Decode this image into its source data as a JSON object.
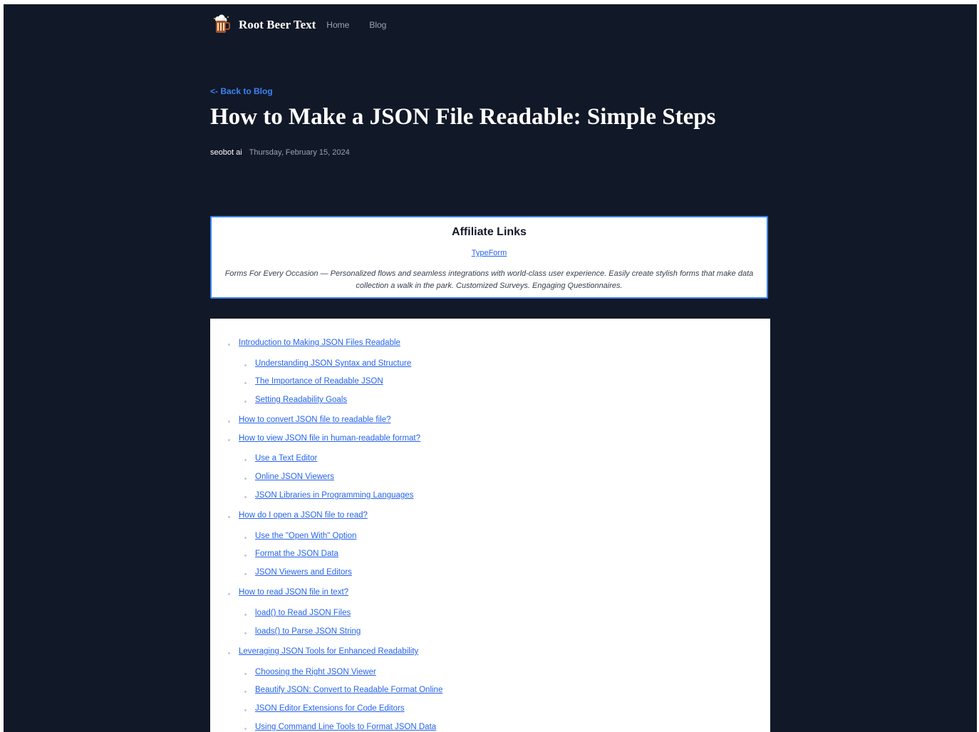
{
  "header": {
    "brand": "Root Beer Text",
    "nav": [
      {
        "label": "Home"
      },
      {
        "label": "Blog"
      }
    ]
  },
  "post": {
    "back_link": "<- Back to Blog",
    "title": "How to Make a JSON File Readable: Simple Steps",
    "author": "seobot ai",
    "date": "Thursday, February 15, 2024"
  },
  "affiliate": {
    "title": "Affiliate Links",
    "link_text": "TypeForm",
    "description": "Forms For Every Occasion — Personalized flows and seamless integrations with world-class user experience. Easily create stylish forms that make data collection a walk in the park. Customized Surveys. Engaging Questionnaires."
  },
  "toc": [
    {
      "level": 1,
      "label": "Introduction to Making JSON Files Readable"
    },
    {
      "level": 2,
      "label": "Understanding JSON Syntax and Structure"
    },
    {
      "level": 2,
      "label": "The Importance of Readable JSON"
    },
    {
      "level": 2,
      "label": "Setting Readability Goals"
    },
    {
      "level": 1,
      "label": "How to convert JSON file to readable file?"
    },
    {
      "level": 1,
      "label": "How to view JSON file in human-readable format?"
    },
    {
      "level": 2,
      "label": "Use a Text Editor"
    },
    {
      "level": 2,
      "label": "Online JSON Viewers"
    },
    {
      "level": 2,
      "label": "JSON Libraries in Programming Languages"
    },
    {
      "level": 1,
      "label": "How do I open a JSON file to read?"
    },
    {
      "level": 2,
      "label": "Use the \"Open With\" Option"
    },
    {
      "level": 2,
      "label": "Format the JSON Data"
    },
    {
      "level": 2,
      "label": "JSON Viewers and Editors"
    },
    {
      "level": 1,
      "label": "How to read JSON file in text?"
    },
    {
      "level": 2,
      "label": "load() to Read JSON Files"
    },
    {
      "level": 2,
      "label": "loads() to Parse JSON String"
    },
    {
      "level": 1,
      "label": "Leveraging JSON Tools for Enhanced Readability"
    },
    {
      "level": 2,
      "label": "Choosing the Right JSON Viewer"
    },
    {
      "level": 2,
      "label": "Beautify JSON: Convert to Readable Format Online"
    },
    {
      "level": 2,
      "label": "JSON Editor Extensions for Code Editors"
    },
    {
      "level": 2,
      "label": "Using Command Line Tools to Format JSON Data"
    }
  ]
}
